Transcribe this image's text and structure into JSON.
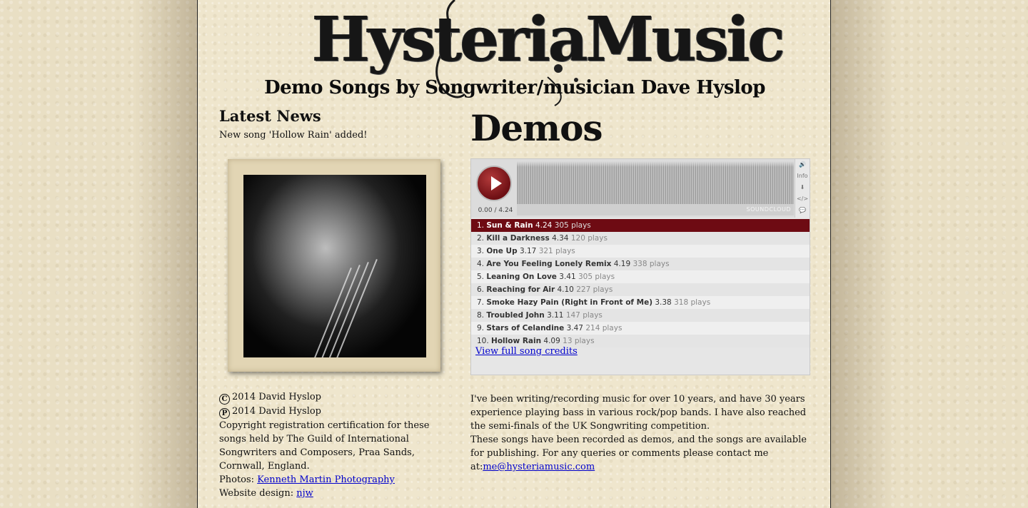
{
  "header": {
    "logo_text": "HysteriaMusic",
    "tagline": "Demo Songs by Songwriter/musician Dave Hyslop"
  },
  "news": {
    "title": "Latest News",
    "text": "New song 'Hollow Rain' added!"
  },
  "photo": {
    "alt": "Dave Hyslop portrait"
  },
  "footer": {
    "copyright_symbol": "C",
    "copyright_text": "2014 David Hyslop",
    "phonogram_symbol": "P",
    "phonogram_text": "2014 David Hyslop",
    "registration_text": "Copyright registration certification for these songs held by The Guild of International Songwriters and Composers, Praa Sands, Cornwall, England.",
    "photos_label": "Photos: ",
    "photos_link": "Kenneth Martin Photography",
    "design_label": "Website design: ",
    "design_link": "njw"
  },
  "main": {
    "title": "Demos",
    "player": {
      "time": "0.00 / 4.24",
      "brand": "SOUNDCLOUD",
      "side_buttons": [
        "🔊",
        "Info",
        "⬇",
        "</>",
        "💬"
      ],
      "tracks": [
        {
          "num": "1.",
          "name": "Sun & Rain",
          "len": "4.24",
          "plays": "305 plays"
        },
        {
          "num": "2.",
          "name": "Kill a Darkness",
          "len": "4.34",
          "plays": "120 plays"
        },
        {
          "num": "3.",
          "name": "One Up",
          "len": "3.17",
          "plays": "321 plays"
        },
        {
          "num": "4.",
          "name": "Are You Feeling Lonely Remix",
          "len": "4.19",
          "plays": "338 plays"
        },
        {
          "num": "5.",
          "name": "Leaning On Love",
          "len": "3.41",
          "plays": "305 plays"
        },
        {
          "num": "6.",
          "name": "Reaching for Air",
          "len": "4.10",
          "plays": "227 plays"
        },
        {
          "num": "7.",
          "name": "Smoke Hazy Pain (Right in Front of Me)",
          "len": "3.38",
          "plays": "318 plays"
        },
        {
          "num": "8.",
          "name": "Troubled John",
          "len": "3.11",
          "plays": "147 plays"
        },
        {
          "num": "9.",
          "name": "Stars of Celandine",
          "len": "3.47",
          "plays": "214 plays"
        },
        {
          "num": "10.",
          "name": "Hollow Rain",
          "len": "4.09",
          "plays": "13 plays"
        }
      ],
      "active_index": 0,
      "credits_link": "View full song credits"
    },
    "bio": {
      "p1": "I've been writing/recording music for over 10 years, and have 30 years experience playing bass in various rock/pop bands. I have also reached the semi-finals of the UK Songwriting competition.",
      "p2": "These songs have been recorded as demos, and the songs are available for publishing. For any queries or comments please contact me at:",
      "email": "me@hysteriamusic.com"
    }
  }
}
